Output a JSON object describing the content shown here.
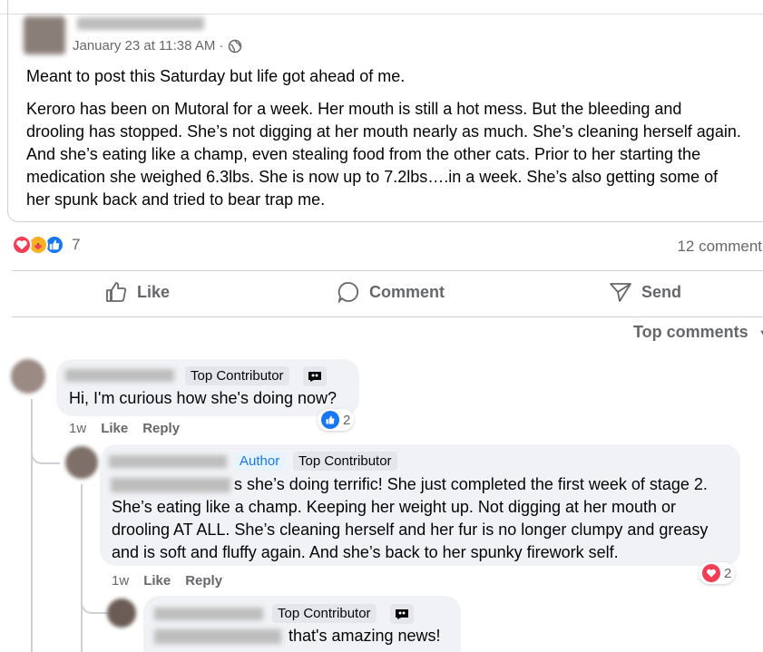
{
  "post": {
    "timestamp": "January 23 at 11:38 AM ·",
    "line1": "Meant to post this Saturday but life got ahead of me.",
    "body": "Keroro has been on Mutoral for a week.  Her mouth is still a hot mess.  But the bleeding and drooling has stopped.  She’s not digging at her mouth nearly as much.  She’s cleaning herself again.  And she’s eating like a champ, even stealing food from the other cats.  Prior to her starting the medication she weighed 6.3lbs.  She is now up to 7.2lbs….in a week.  She’s also getting some of her spunk back and tried to bear trap me."
  },
  "stats": {
    "reaction_count": "7",
    "comment_count": "12 comment"
  },
  "actions": {
    "like": "Like",
    "comment": "Comment",
    "send": "Send"
  },
  "sort_label": "Top comments",
  "comments": [
    {
      "badge": "Top Contributor",
      "text": "Hi, I'm curious how she's doing now?",
      "time": "1w",
      "like": "Like",
      "reply": "Reply",
      "reaction_count": "2"
    },
    {
      "badge_author": "Author",
      "badge": "Top Contributor",
      "text_line1": "s she’s doing terrific! She just completed the first week of stage 2.",
      "text_rest": "She’s eating like a champ. Keeping her weight up. Not digging at her mouth or drooling AT ALL. She’s cleaning herself and her fur is no longer clumpy and greasy and is soft and fluffy again. And she’s back to her spunky firework self.",
      "time": "1w",
      "like": "Like",
      "reply": "Reply",
      "reaction_count": "2"
    },
    {
      "badge": "Top Contributor",
      "text": "that's amazing news!"
    }
  ],
  "colors": {
    "like_blue": "#1877f2",
    "love_red": "#f33e58",
    "care_yellow": "#f7b125"
  }
}
